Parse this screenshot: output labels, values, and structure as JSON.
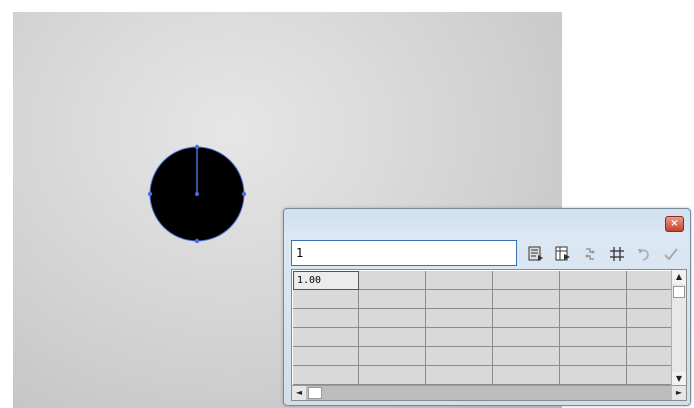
{
  "input": {
    "value": "1"
  },
  "toolbar": {
    "icons": [
      "import-icon",
      "export-icon",
      "link-icon",
      "grid-settings-icon",
      "undo-icon",
      "checkmark-icon"
    ]
  },
  "grid": {
    "active_cell_value": "1.00",
    "columns": 6,
    "rows": 6
  },
  "colors": {
    "circle_fill": "#000000",
    "selection_accent": "#4a6fd8",
    "close_button": "#c8412c"
  }
}
